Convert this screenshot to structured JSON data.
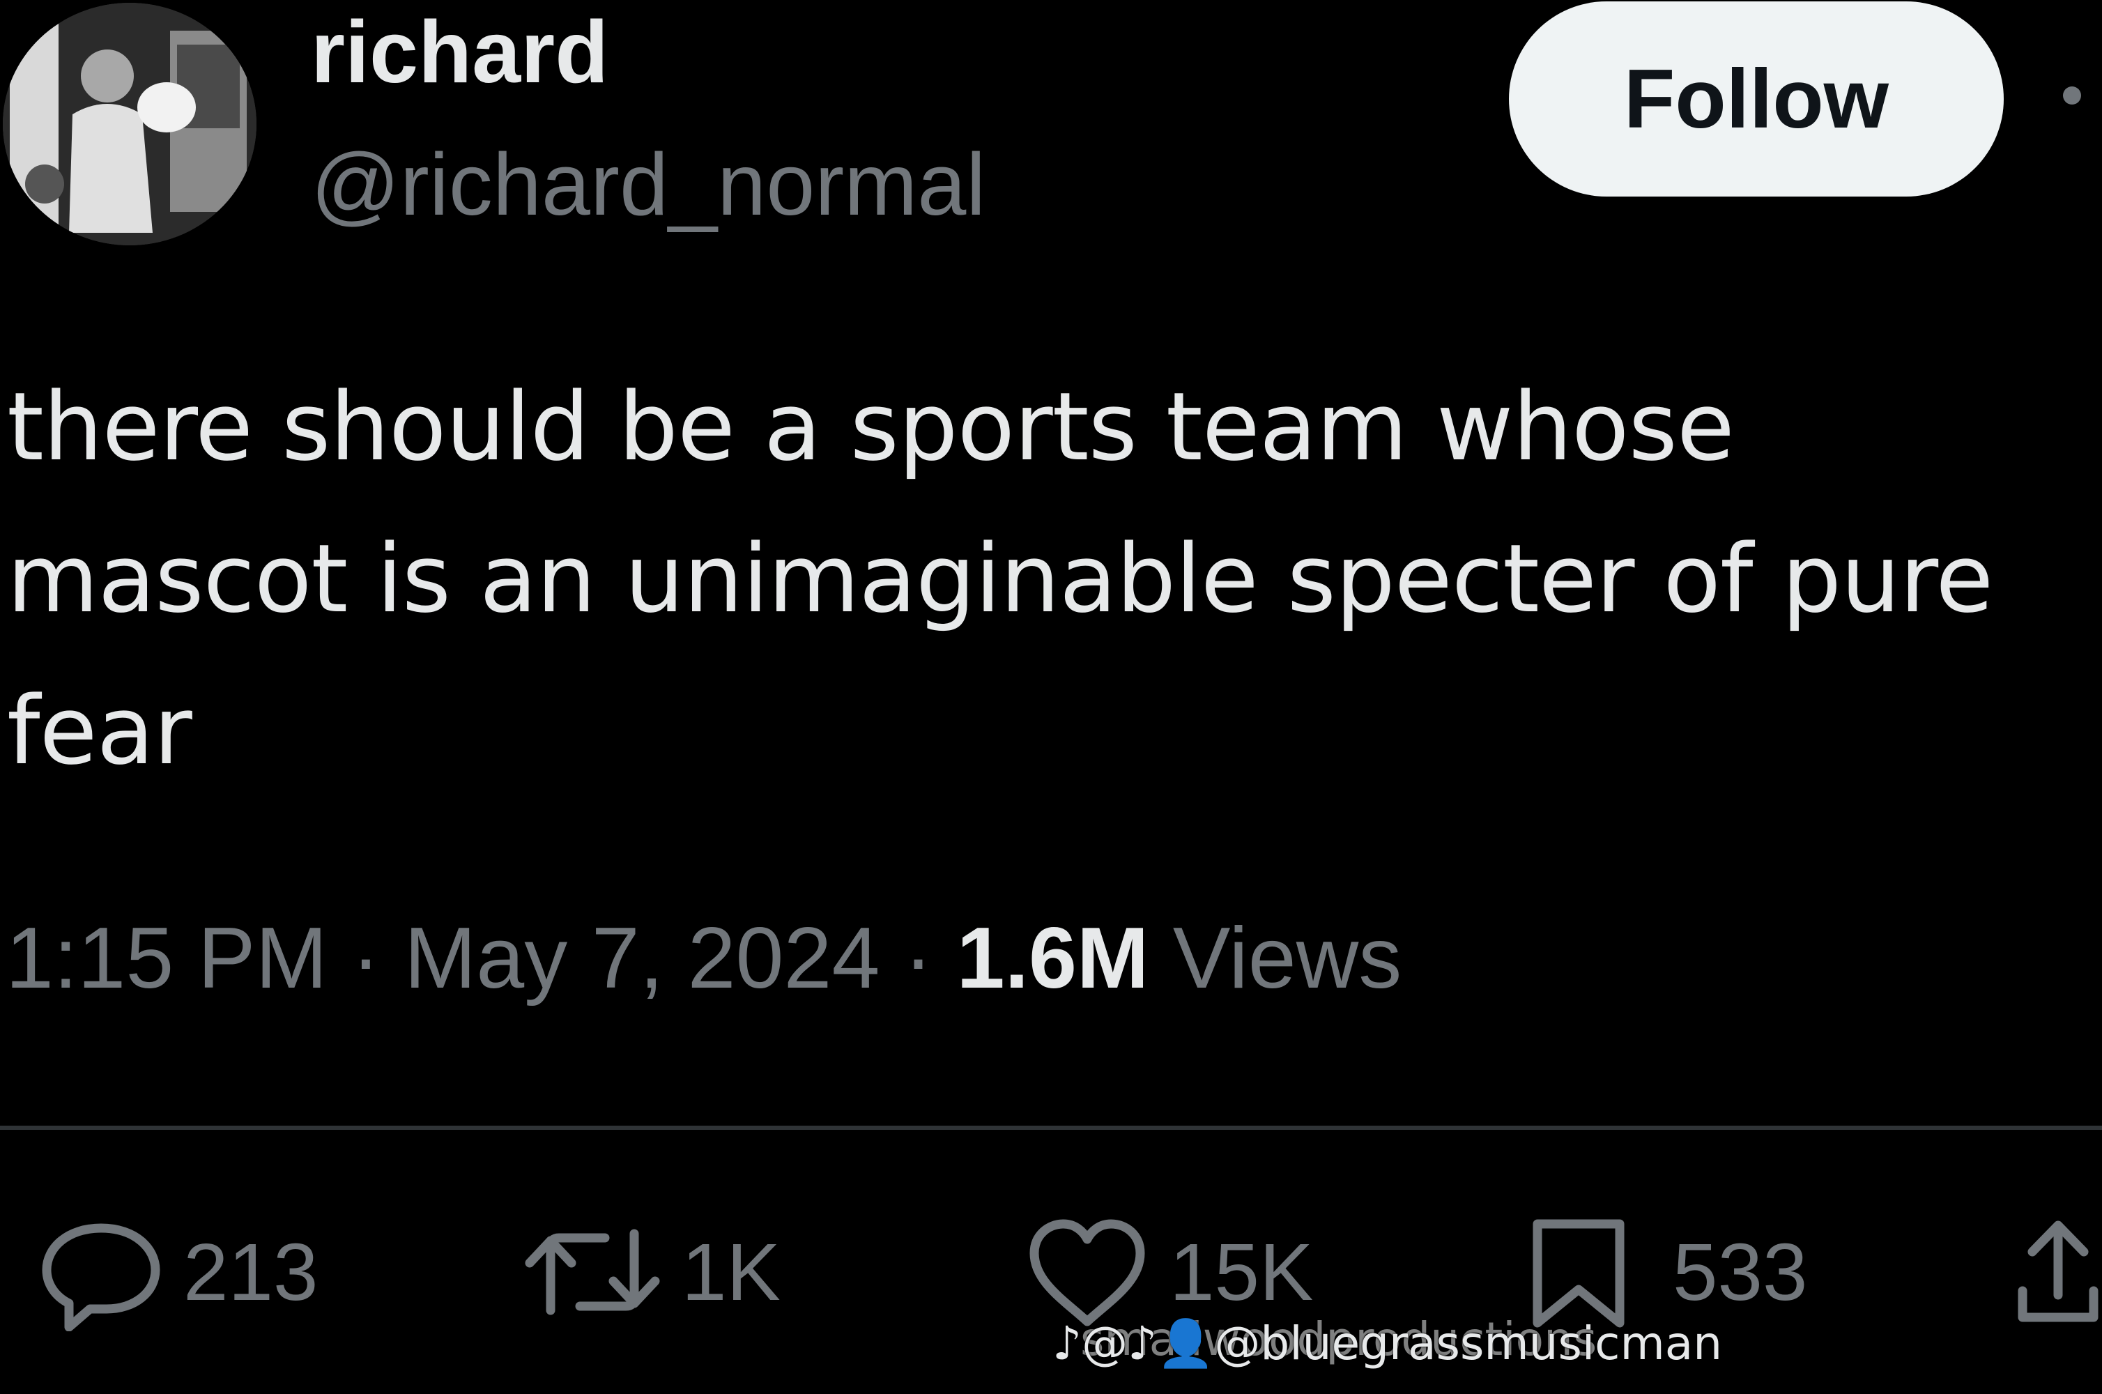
{
  "user": {
    "display_name": "richard",
    "handle": "@richard_normal"
  },
  "follow_label": "Follow",
  "tweet": {
    "text": "there should be a sports team whose\nmascot is an unimaginable specter of pure\nfear",
    "time": "1:15 PM",
    "date": "May 7, 2024",
    "separator": " · ",
    "views_count": "1.6M",
    "views_label": " Views"
  },
  "actions": {
    "replies": "213",
    "reposts": "1K",
    "likes": "15K",
    "bookmarks": "533"
  },
  "icons": {
    "reply": "reply-icon",
    "repost": "repost-icon",
    "like": "heart-icon",
    "bookmark": "bookmark-icon",
    "share": "share-icon",
    "more": "more-icon"
  },
  "watermarks": {
    "primary": "♪@♪👤@bluegrassmusicman",
    "secondary": "smallwoodproductions"
  },
  "colors": {
    "background": "#000000",
    "primary_text": "#e7e9ea",
    "secondary_text": "#71767b",
    "follow_button_bg": "#eff3f4",
    "divider": "#2f3336"
  }
}
